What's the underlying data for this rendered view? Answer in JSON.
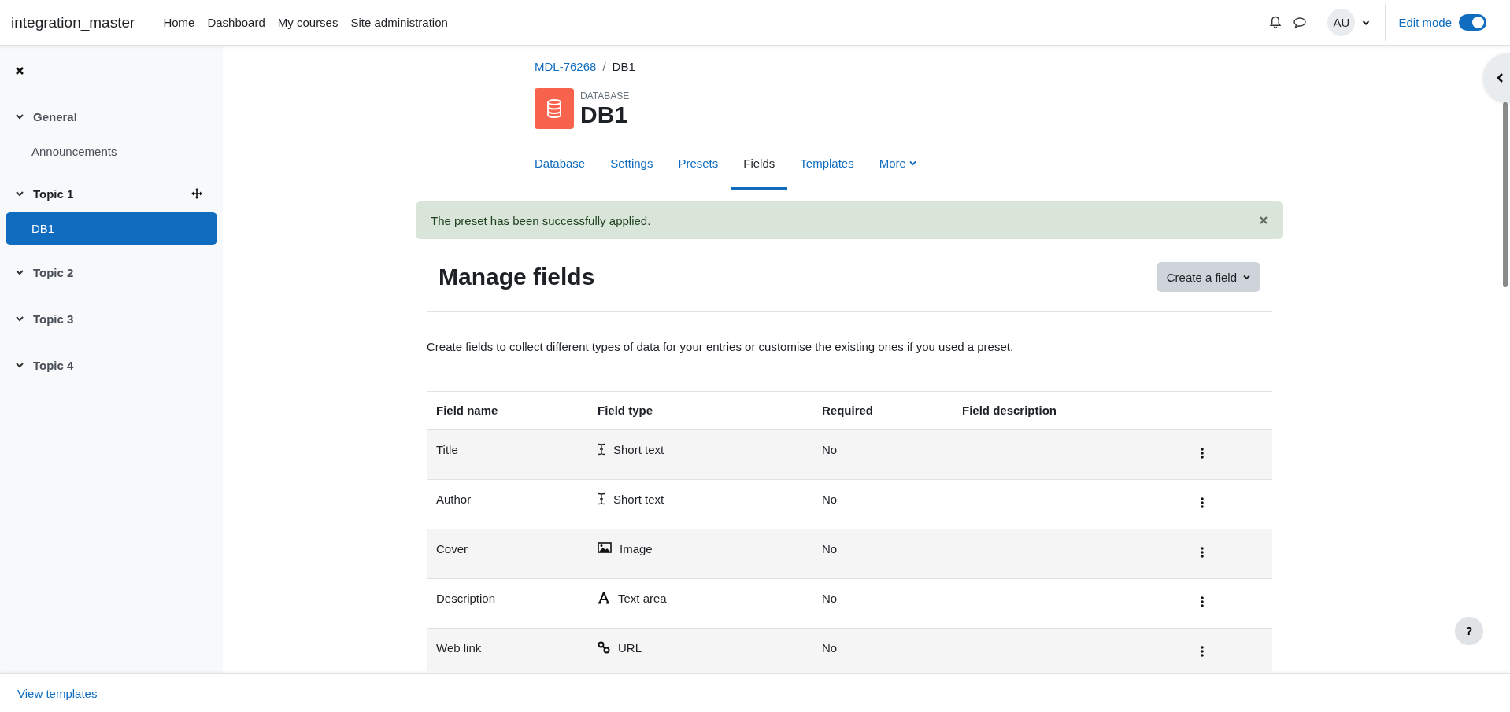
{
  "navbar": {
    "site_name": "integration_master",
    "links": [
      "Home",
      "Dashboard",
      "My courses",
      "Site administration"
    ],
    "avatar": "AU",
    "edit_mode": {
      "label": "Edit mode",
      "on": true
    }
  },
  "sidebar": {
    "sections": [
      {
        "title": "General",
        "current": false,
        "movable": false,
        "items": [
          {
            "label": "Announcements",
            "selected": false
          }
        ]
      },
      {
        "title": "Topic 1",
        "current": true,
        "movable": true,
        "items": [
          {
            "label": "DB1",
            "selected": true
          }
        ]
      },
      {
        "title": "Topic 2",
        "current": false,
        "movable": false
      },
      {
        "title": "Topic 3",
        "current": false,
        "movable": false
      },
      {
        "title": "Topic 4",
        "current": false,
        "movable": false
      }
    ]
  },
  "breadcrumb": {
    "separator": "/",
    "items": [
      {
        "label": "MDL-76268",
        "link": true
      },
      {
        "label": "DB1",
        "link": false
      }
    ]
  },
  "activity": {
    "type_label": "DATABASE",
    "title": "DB1"
  },
  "tabs": [
    {
      "label": "Database",
      "selected": false,
      "menu": false
    },
    {
      "label": "Settings",
      "selected": false,
      "menu": false
    },
    {
      "label": "Presets",
      "selected": false,
      "menu": false
    },
    {
      "label": "Fields",
      "selected": true,
      "menu": false
    },
    {
      "label": "Templates",
      "selected": false,
      "menu": false
    },
    {
      "label": "More",
      "selected": false,
      "menu": true
    }
  ],
  "alert": {
    "message": "The preset has been successfully applied."
  },
  "heading": "Manage fields",
  "create_button": "Create a field",
  "intro": "Create fields to collect different types of data for your entries or customise the existing ones if you used a preset.",
  "table": {
    "columns": [
      "Field name",
      "Field type",
      "Required",
      "Field description"
    ],
    "rows": [
      {
        "name": "Title",
        "type": "Short text",
        "kind": "text",
        "required": "No"
      },
      {
        "name": "Author",
        "type": "Short text",
        "kind": "text",
        "required": "No"
      },
      {
        "name": "Cover",
        "type": "Image",
        "kind": "image",
        "required": "No"
      },
      {
        "name": "Description",
        "type": "Text area",
        "kind": "textarea",
        "required": "No"
      },
      {
        "name": "Web link",
        "type": "URL",
        "kind": "url",
        "required": "No"
      }
    ]
  },
  "footer": {
    "link": "View templates"
  },
  "help_button": "?"
}
